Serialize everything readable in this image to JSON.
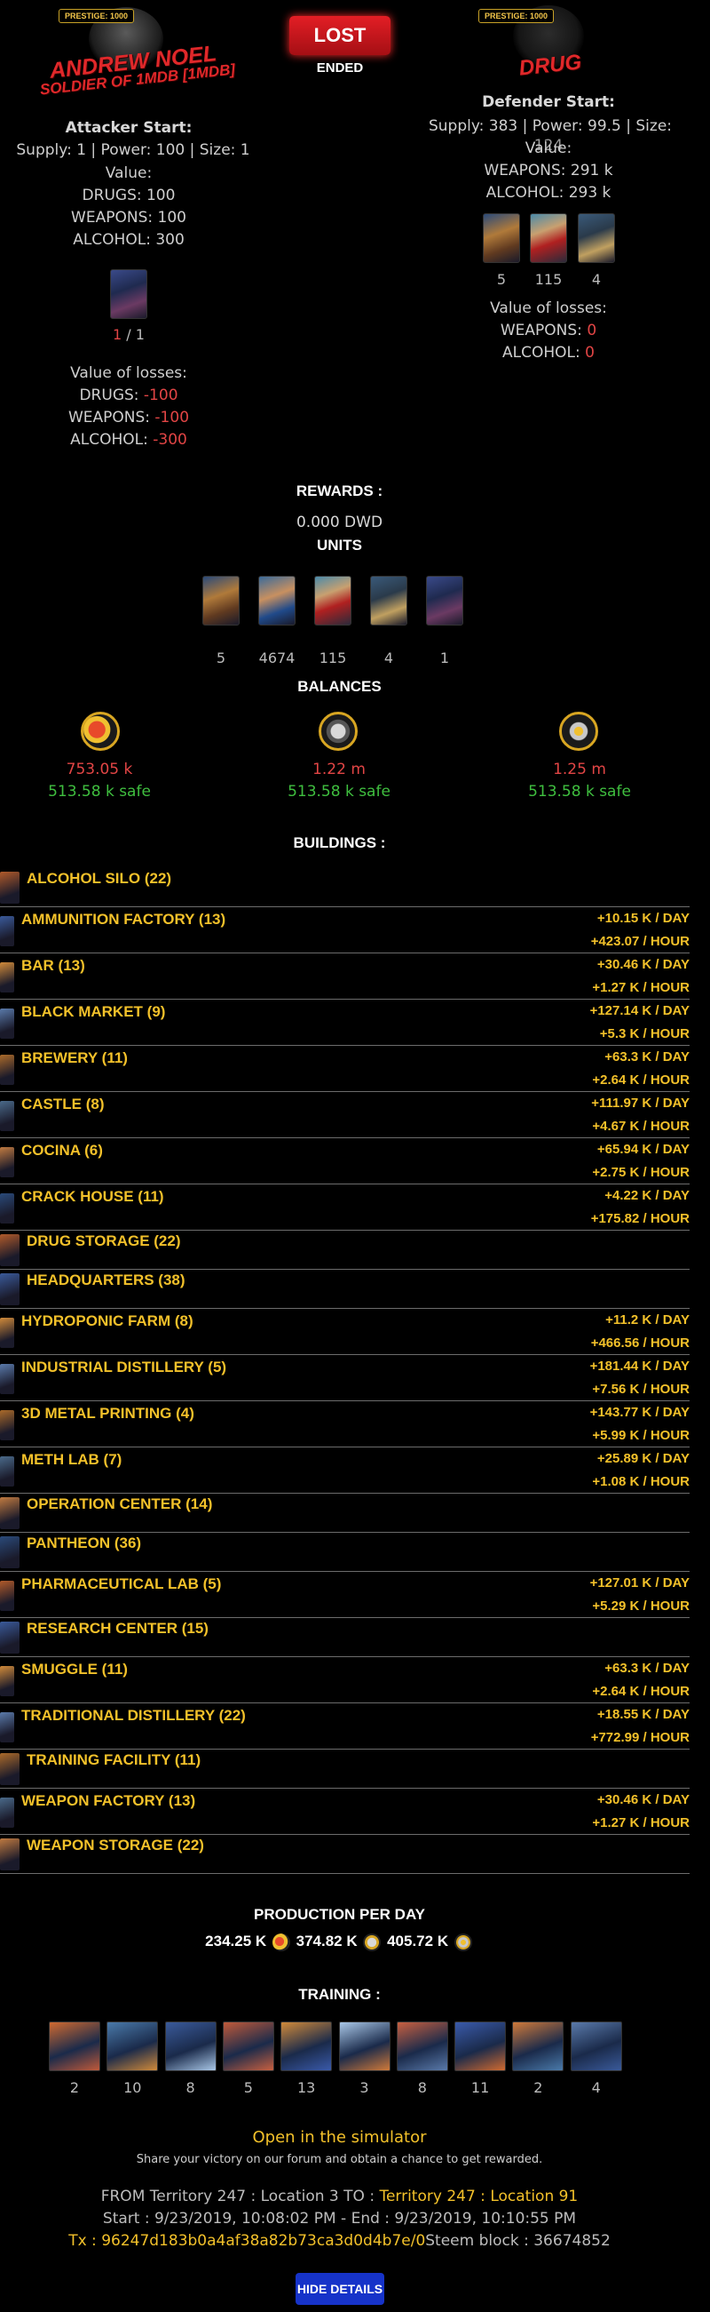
{
  "attacker": {
    "prestige": "PRESTIGE: 1000",
    "name": "ANDREW NOEL",
    "subtitle": "SOLDIER OF 1MDB [1MDB]",
    "start_title": "Attacker Start:",
    "start_stats": "Supply: 1 | Power: 100 | Size: 1",
    "value_title": "Value:",
    "values": [
      "DRUGS: 100",
      "WEAPONS: 100",
      "ALCOHOL: 300"
    ],
    "unit_count_left": "1",
    "unit_count_right": " / 1",
    "losses_title": "Value of losses:",
    "losses": [
      {
        "label": "DRUGS: ",
        "value": "-100"
      },
      {
        "label": "WEAPONS: ",
        "value": "-100"
      },
      {
        "label": "ALCOHOL: ",
        "value": "-300"
      }
    ]
  },
  "result": {
    "status": "LOST",
    "state": "ENDED"
  },
  "defender": {
    "prestige": "PRESTIGE: 1000",
    "name": "DRUG",
    "start_title": "Defender Start:",
    "start_stats": "Supply: 383 | Power: 99.5 | Size:",
    "size_value": "124",
    "value_title": "Value:",
    "values": [
      "WEAPONS: 291 k",
      "ALCOHOL: 293 k"
    ],
    "unit_counts": [
      "5",
      "115",
      "4"
    ],
    "losses_title": "Value of losses:",
    "losses": [
      {
        "label": "WEAPONS: ",
        "value": "0"
      },
      {
        "label": "ALCOHOL: ",
        "value": "0"
      }
    ]
  },
  "rewards": {
    "title": "REWARDS :",
    "dwd": "0.000 DWD",
    "units_title": "UNITS",
    "unit_counts": [
      "5",
      "4674",
      "115",
      "4",
      "1"
    ],
    "balances_title": "BALANCES",
    "balances": [
      {
        "icon": "drugs-icon",
        "amount": "753.05 k",
        "safe": "513.58 k safe"
      },
      {
        "icon": "weapons-icon",
        "amount": "1.22 m",
        "safe": "513.58 k safe"
      },
      {
        "icon": "alcohol-icon",
        "amount": "1.25 m",
        "safe": "513.58 k safe"
      }
    ]
  },
  "buildings": {
    "title": "BUILDINGS :",
    "items": [
      {
        "name": "ALCOHOL SILO (22)",
        "day": "",
        "hour": ""
      },
      {
        "name": "AMMUNITION FACTORY (13)",
        "day": "+10.15 K / DAY",
        "hour": "+423.07 / HOUR"
      },
      {
        "name": "BAR (13)",
        "day": "+30.46 K / DAY",
        "hour": "+1.27 K / HOUR"
      },
      {
        "name": "BLACK MARKET (9)",
        "day": "+127.14 K / DAY",
        "hour": "+5.3 K / HOUR"
      },
      {
        "name": "BREWERY (11)",
        "day": "+63.3 K / DAY",
        "hour": "+2.64 K / HOUR"
      },
      {
        "name": "CASTLE (8)",
        "day": "+111.97 K / DAY",
        "hour": "+4.67 K / HOUR"
      },
      {
        "name": "COCINA (6)",
        "day": "+65.94 K / DAY",
        "hour": "+2.75 K / HOUR"
      },
      {
        "name": "CRACK HOUSE (11)",
        "day": "+4.22 K / DAY",
        "hour": "+175.82 / HOUR"
      },
      {
        "name": "DRUG STORAGE (22)",
        "day": "",
        "hour": ""
      },
      {
        "name": "HEADQUARTERS (38)",
        "day": "",
        "hour": ""
      },
      {
        "name": "HYDROPONIC FARM (8)",
        "day": "+11.2 K / DAY",
        "hour": "+466.56 / HOUR"
      },
      {
        "name": "INDUSTRIAL DISTILLERY (5)",
        "day": "+181.44 K / DAY",
        "hour": "+7.56 K / HOUR"
      },
      {
        "name": "3D METAL PRINTING (4)",
        "day": "+143.77 K / DAY",
        "hour": "+5.99 K / HOUR"
      },
      {
        "name": "METH LAB (7)",
        "day": "+25.89 K / DAY",
        "hour": "+1.08 K / HOUR"
      },
      {
        "name": "OPERATION CENTER (14)",
        "day": "",
        "hour": ""
      },
      {
        "name": "PANTHEON (36)",
        "day": "",
        "hour": ""
      },
      {
        "name": "PHARMACEUTICAL LAB (5)",
        "day": "+127.01 K / DAY",
        "hour": "+5.29 K / HOUR"
      },
      {
        "name": "RESEARCH CENTER (15)",
        "day": "",
        "hour": ""
      },
      {
        "name": "SMUGGLE (11)",
        "day": "+63.3 K / DAY",
        "hour": "+2.64 K / HOUR"
      },
      {
        "name": "TRADITIONAL DISTILLERY (22)",
        "day": "+18.55 K / DAY",
        "hour": "+772.99 / HOUR"
      },
      {
        "name": "TRAINING FACILITY (11)",
        "day": "",
        "hour": ""
      },
      {
        "name": "WEAPON FACTORY (13)",
        "day": "+30.46 K / DAY",
        "hour": "+1.27 K / HOUR"
      },
      {
        "name": "WEAPON STORAGE (22)",
        "day": "",
        "hour": ""
      }
    ]
  },
  "production": {
    "title": "PRODUCTION PER DAY",
    "drugs": "234.25 K",
    "weapons": "374.82 K",
    "alcohol": "405.72 K"
  },
  "training": {
    "title": "TRAINING :",
    "counts": [
      "2",
      "10",
      "8",
      "5",
      "13",
      "3",
      "8",
      "11",
      "2",
      "4"
    ]
  },
  "footer": {
    "simulator": "Open in the simulator",
    "share": "Share your victory on our forum and obtain a chance to get rewarded.",
    "from_prefix": "FROM Territory 247 : Location 3 TO : ",
    "to_location": "Territory 247 : Location 91",
    "times": "Start : 9/23/2019, 10:08:02 PM - End : 9/23/2019, 10:10:55 PM",
    "tx_label": "Tx : ",
    "tx_hash": "96247d183b0a4af38a82b73ca3d0d4b7e/0",
    "block": "Steem block : 36674852",
    "hide_button": "HIDE DETAILS"
  },
  "colors": {
    "accent_gold": "#f3c12a",
    "negative_red": "#e24545",
    "safe_green": "#3fbf3f",
    "lost_red": "#e31e25",
    "button_blue": "#1633c9"
  }
}
